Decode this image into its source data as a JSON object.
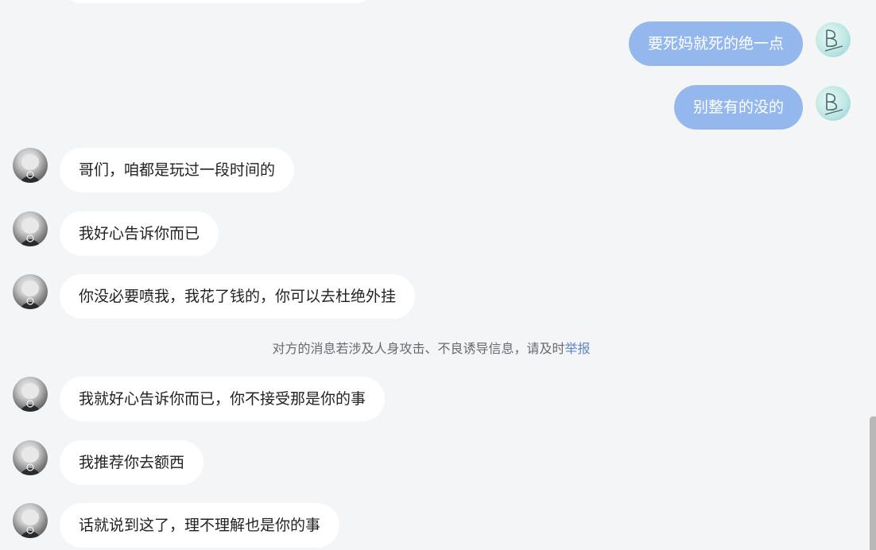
{
  "messages": [
    {
      "side": "out",
      "text": "要死妈就死的绝一点"
    },
    {
      "side": "out",
      "text": "别整有的没的"
    },
    {
      "side": "in",
      "text": "哥们，咱都是玩过一段时间的"
    },
    {
      "side": "in",
      "text": "我好心告诉你而已"
    },
    {
      "side": "in",
      "text": "你没必要喷我，我花了钱的，你可以去杜绝外挂"
    },
    {
      "side": "in",
      "text": "我就好心告诉你而已，你不接受那是你的事"
    },
    {
      "side": "in",
      "text": "我推荐你去额西"
    },
    {
      "side": "in",
      "text": "话就说到这了，理不理解也是你的事"
    }
  ],
  "notice": {
    "text": "对方的消息若涉及人身攻击、不良诱导信息，请及时",
    "report_link": "举报"
  },
  "colors": {
    "background": "#f4f5f7",
    "outgoing_bubble": "#94b8ee",
    "incoming_bubble": "#ffffff",
    "report_link": "#5b86c4"
  },
  "icons": {
    "peer_avatar": "anime-character-avatar-icon",
    "self_avatar": "letter-b-signature-avatar-icon"
  }
}
